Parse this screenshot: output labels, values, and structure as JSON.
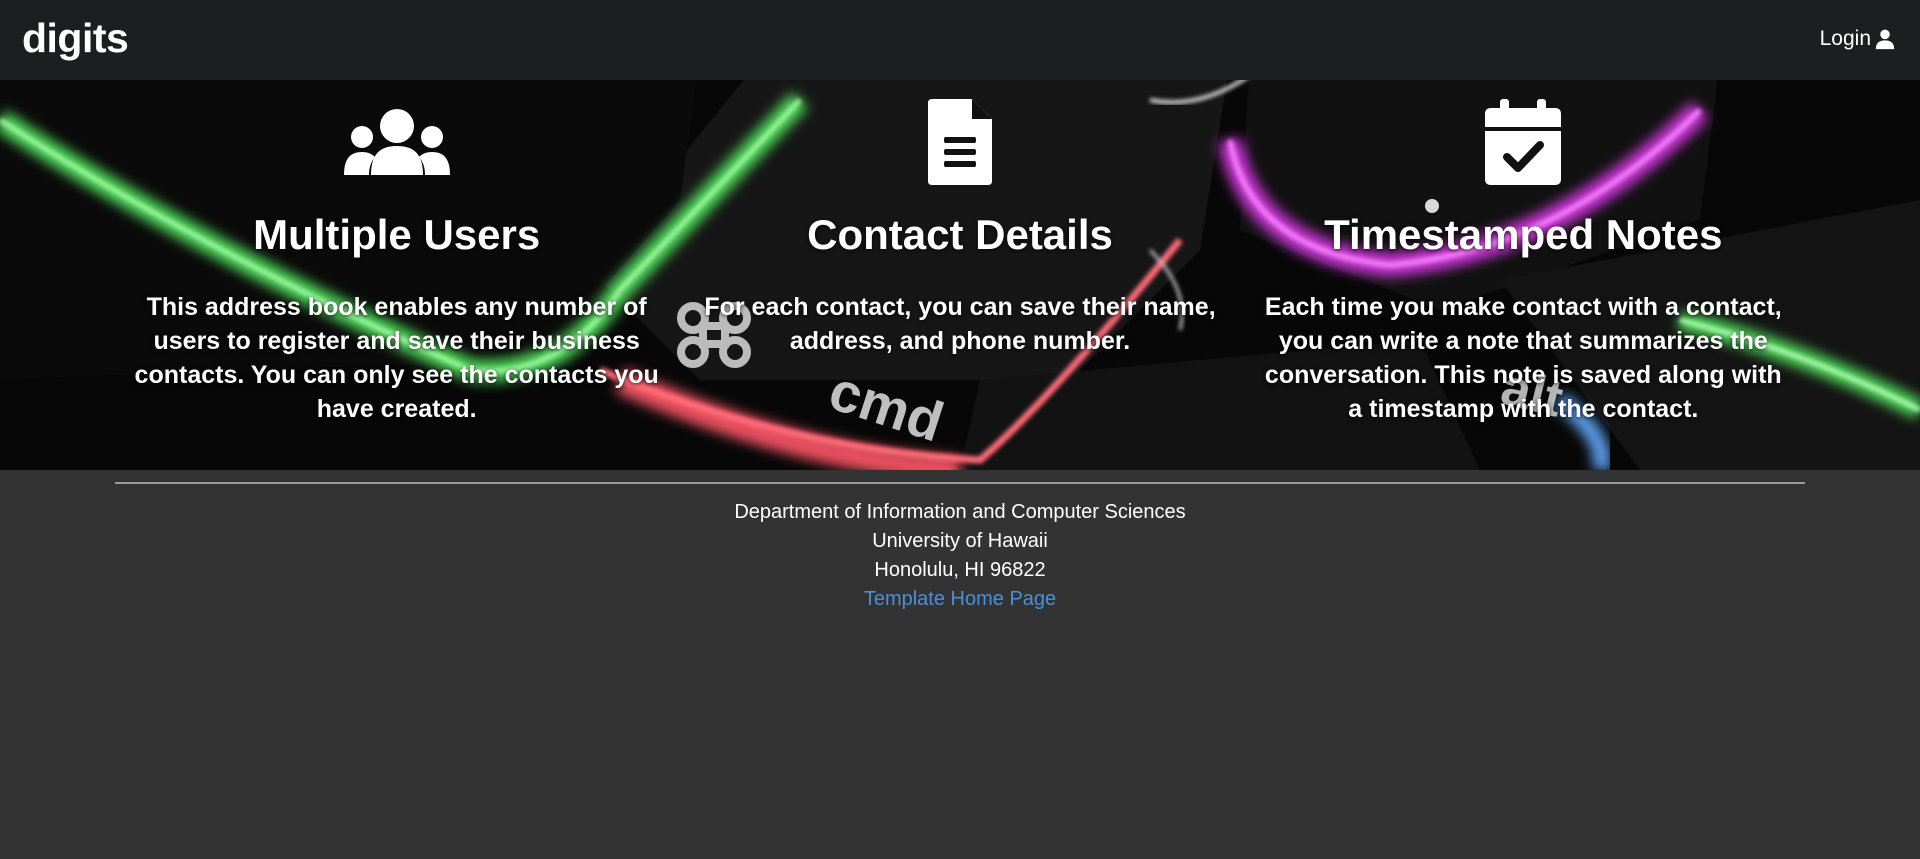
{
  "navbar": {
    "brand": "digits",
    "login_label": "Login",
    "login_icon": "user-icon"
  },
  "features": [
    {
      "icon": "users-icon",
      "title": "Multiple Users",
      "text": "This address book enables any number of users to register and save their business contacts. You can only see the contacts you have created."
    },
    {
      "icon": "file-alt-icon",
      "title": "Contact Details",
      "text": "For each contact, you can save their name, address, and phone number."
    },
    {
      "icon": "calendar-check-icon",
      "title": "Timestamped Notes",
      "text": "Each time you make contact with a contact, you can write a note that summarizes the conversation. This note is saved along with a timestamp with the contact."
    }
  ],
  "footer": {
    "line1": "Department of Information and Computer Sciences",
    "line2": "University of Hawaii",
    "line3": "Honolulu, HI 96822",
    "link_label": "Template Home Page"
  },
  "colors": {
    "navbar_bg": "#1d1e20",
    "page_bg": "#333333",
    "link": "#4a90d9"
  }
}
